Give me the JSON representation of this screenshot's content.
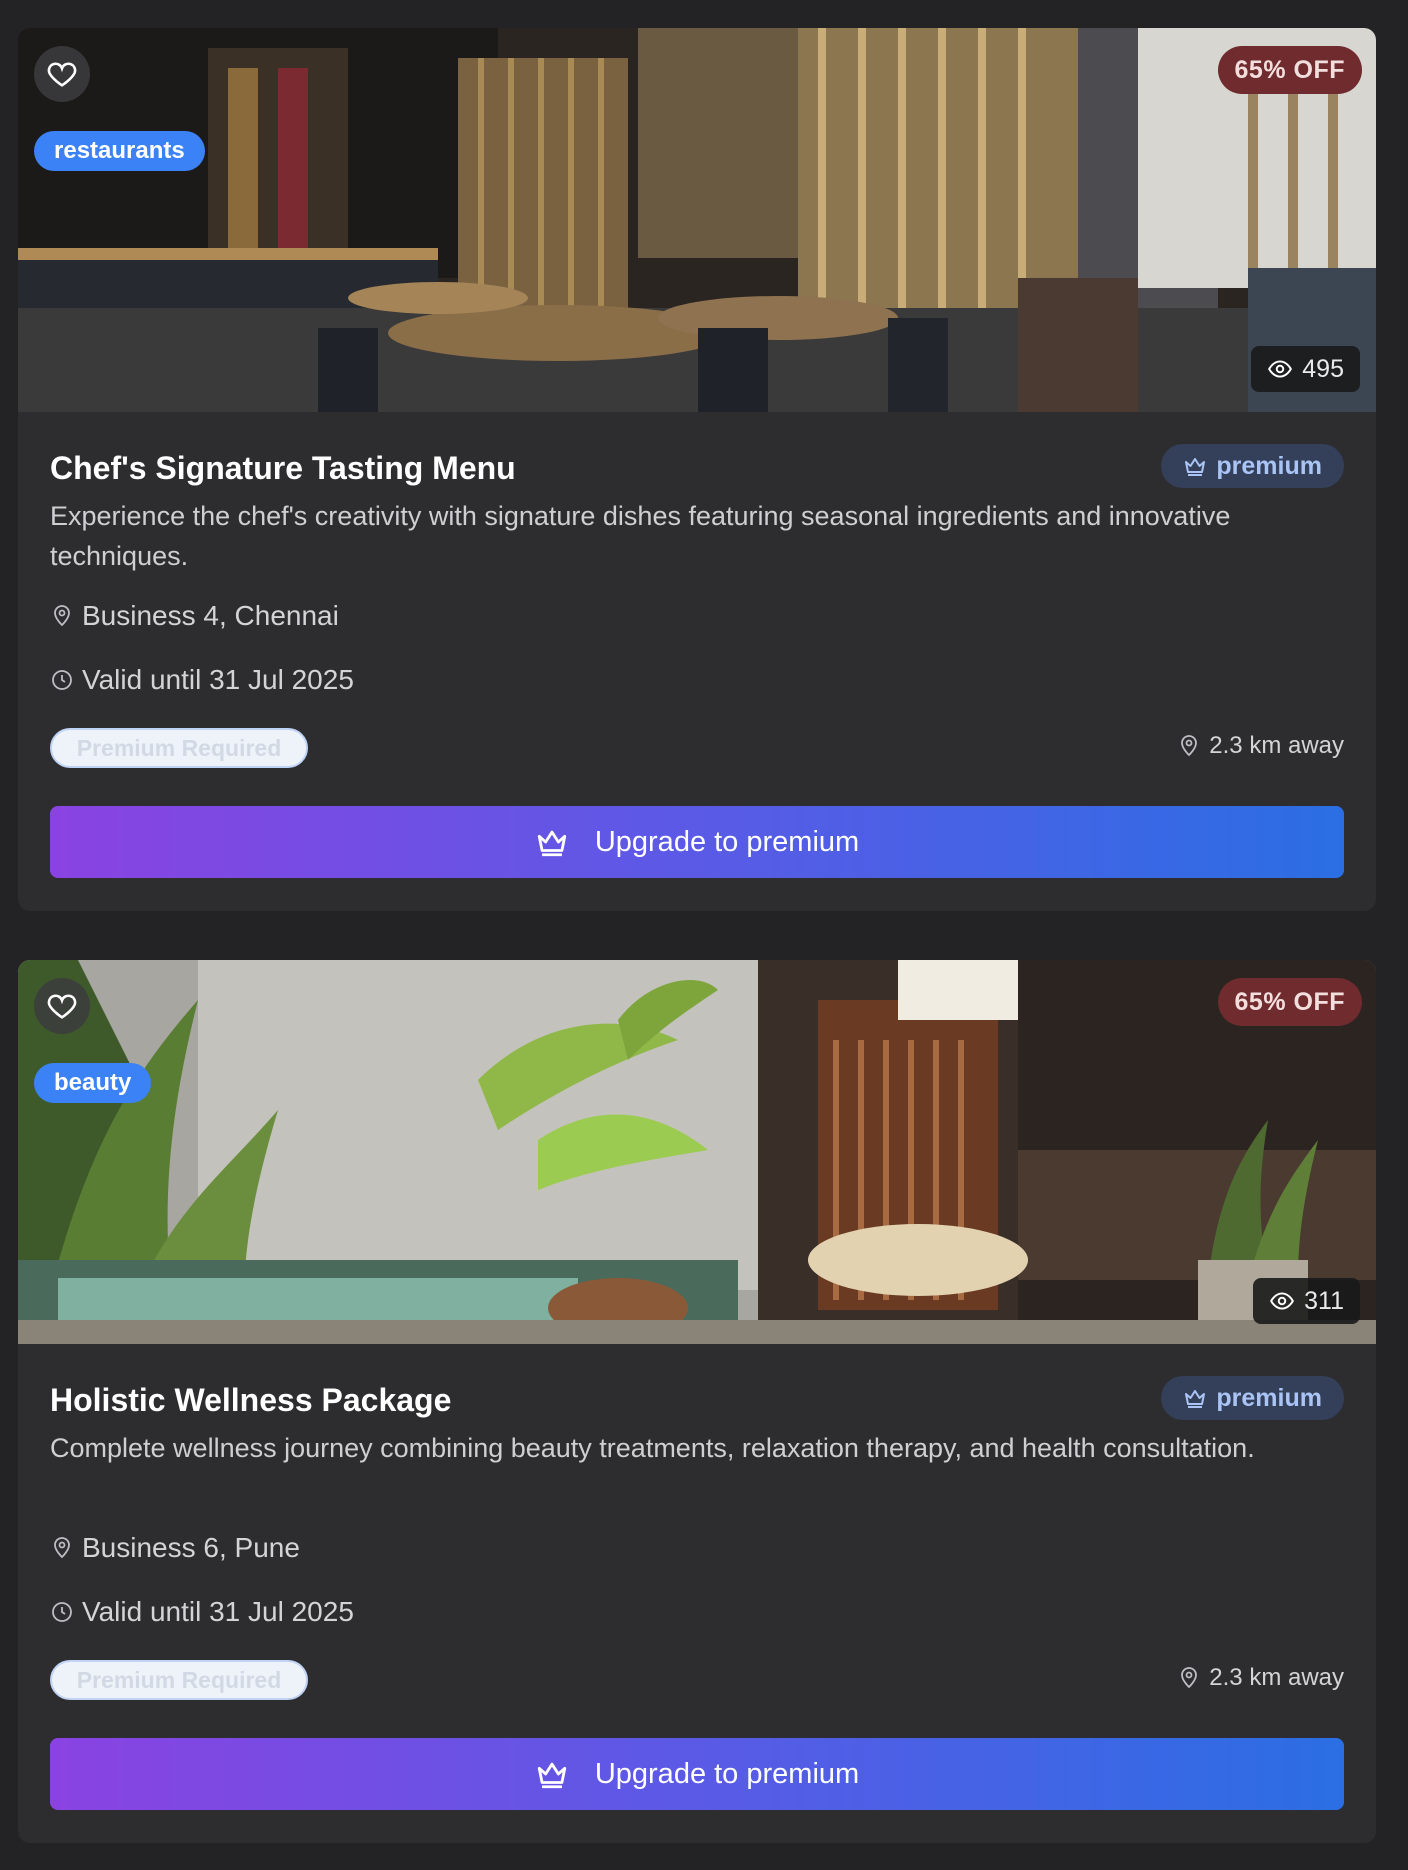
{
  "offers": [
    {
      "category": "restaurants",
      "discount": "65% OFF",
      "views": "495",
      "title": "Chef's Signature Tasting Menu",
      "tier": "premium",
      "description": "Experience the chef's creativity with signature dishes featuring seasonal ingredients and innovative techniques.",
      "location": "Business 4, Chennai",
      "valid": "Valid until 31 Jul 2025",
      "requirement": "Premium Required",
      "distance": "2.3 km away",
      "cta": "Upgrade to premium"
    },
    {
      "category": "beauty",
      "discount": "65% OFF",
      "views": "311",
      "title": "Holistic Wellness Package",
      "tier": "premium",
      "description": "Complete wellness journey combining beauty treatments, relaxation therapy, and health consultation.",
      "location": "Business 6, Pune",
      "valid": "Valid until 31 Jul 2025",
      "requirement": "Premium Required",
      "distance": "2.3 km away",
      "cta": "Upgrade to premium"
    }
  ],
  "icons": {
    "favorite": "heart-icon",
    "views": "eye-icon",
    "tier": "crown-icon",
    "location": "map-pin-icon",
    "valid": "clock-icon",
    "cta": "crown-icon"
  },
  "colors": {
    "background": "#232325",
    "card": "#2d2d2f",
    "category_badge": "#3b82f6",
    "discount_badge": "#6f2b2d",
    "tier_badge": "#34405a",
    "cta_gradient_start": "#8a43e2",
    "cta_gradient_end": "#2b6ee4"
  }
}
